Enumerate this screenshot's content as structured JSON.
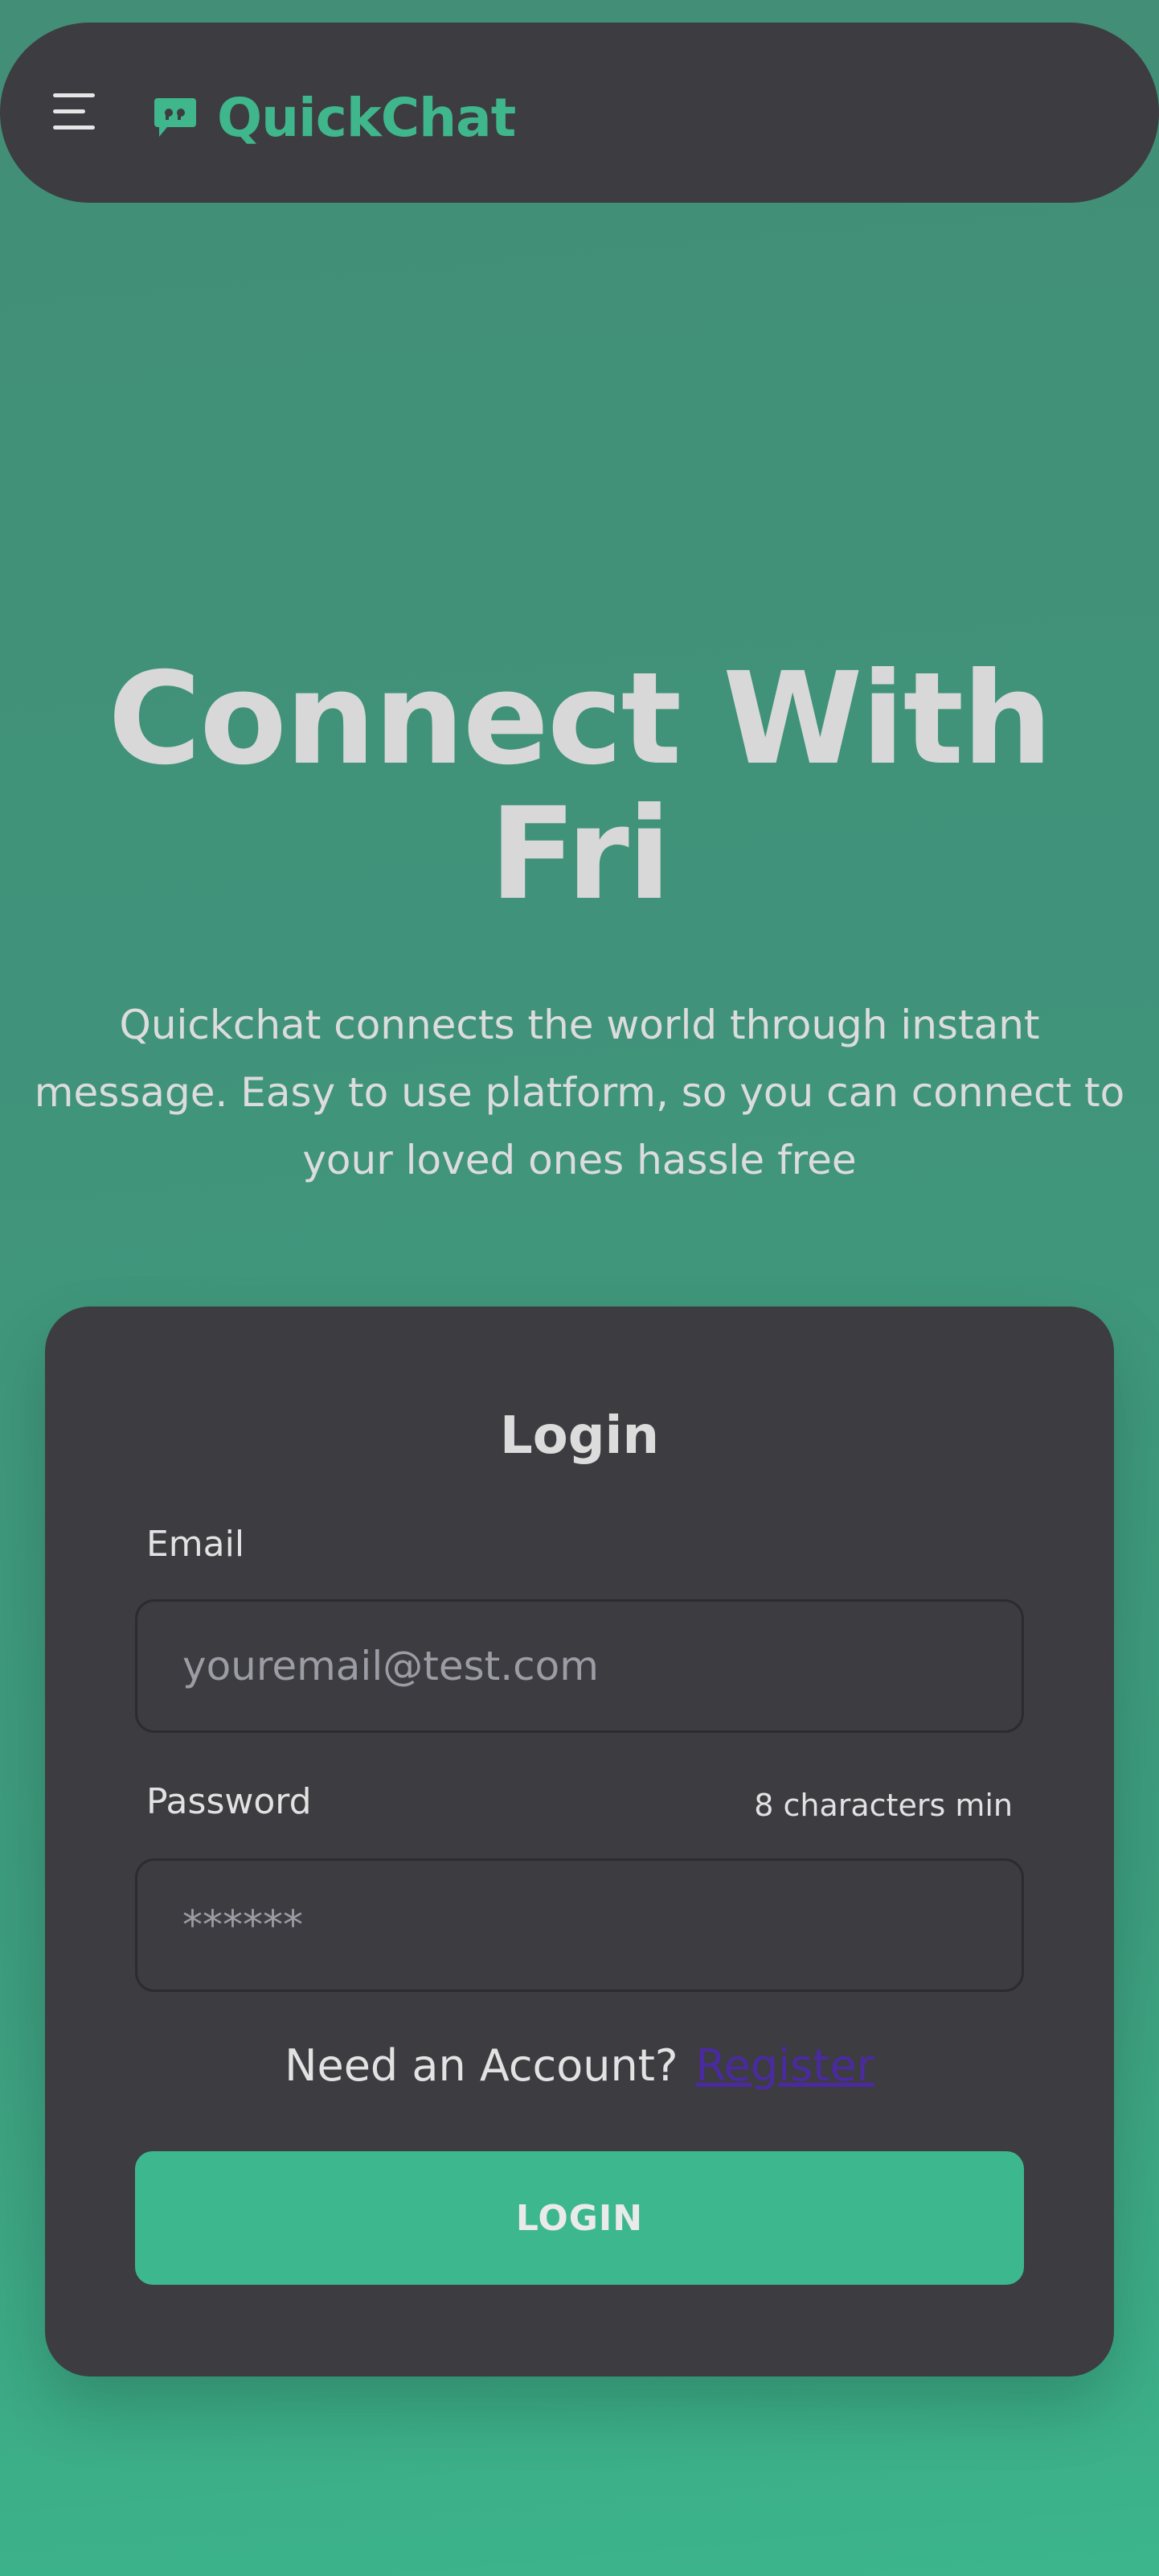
{
  "navbar": {
    "brand_name": "QuickChat",
    "menu_icon": "hamburger-menu-icon",
    "brand_icon": "chat-quote-icon"
  },
  "hero": {
    "title": "Connect With Fri",
    "subtitle": "Quickchat connects the world through instant message. Easy to use platform, so you can connect to your loved ones hassle free"
  },
  "login": {
    "title": "Login",
    "email_label": "Email",
    "email_placeholder": "youremail@test.com",
    "email_value": "",
    "password_label": "Password",
    "password_hint": "8 characters min",
    "password_placeholder": "******",
    "password_value": "",
    "register_prompt": "Need an Account?",
    "register_link": "Register",
    "submit_label": "LOGIN"
  },
  "colors": {
    "accent": "#3fb68b",
    "panel": "#3d3c41",
    "background_top": "#428e76",
    "background_bottom": "#3cb58c",
    "link": "#4a2aa0"
  }
}
